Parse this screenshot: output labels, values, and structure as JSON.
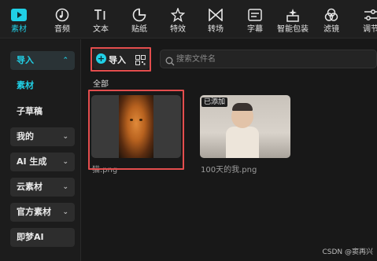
{
  "toolbar": {
    "tools": [
      {
        "label": "素材",
        "icon": "play-icon",
        "active": true
      },
      {
        "label": "音频",
        "icon": "music-icon"
      },
      {
        "label": "文本",
        "icon": "text-icon"
      },
      {
        "label": "贴纸",
        "icon": "sticker-icon"
      },
      {
        "label": "特效",
        "icon": "effects-star-icon"
      },
      {
        "label": "转场",
        "icon": "transition-icon"
      },
      {
        "label": "字幕",
        "icon": "subtitle-icon"
      },
      {
        "label": "智能包装",
        "icon": "smart-pack-icon"
      },
      {
        "label": "滤镜",
        "icon": "filter-icon"
      },
      {
        "label": "调节",
        "icon": "adjust-icon"
      }
    ]
  },
  "sidebar": {
    "items": [
      {
        "label": "导入",
        "chevron": "up"
      },
      {
        "label": "素材"
      },
      {
        "label": "子草稿"
      },
      {
        "label": "我的",
        "chevron": "down"
      },
      {
        "label": "AI 生成",
        "chevron": "down"
      },
      {
        "label": "云素材",
        "chevron": "down"
      },
      {
        "label": "官方素材",
        "chevron": "down"
      },
      {
        "label": "即梦AI"
      }
    ]
  },
  "main": {
    "import_label": "导入",
    "search_placeholder": "搜索文件名",
    "section_label": "全部",
    "media": [
      {
        "filename": "猫.png"
      },
      {
        "filename": "100天的我.png",
        "badge": "已添加"
      }
    ]
  },
  "watermark": "CSDN @窦再兴",
  "colors": {
    "accent": "#20d0e6",
    "highlight_box": "#e34d4d",
    "background": "#181818"
  }
}
